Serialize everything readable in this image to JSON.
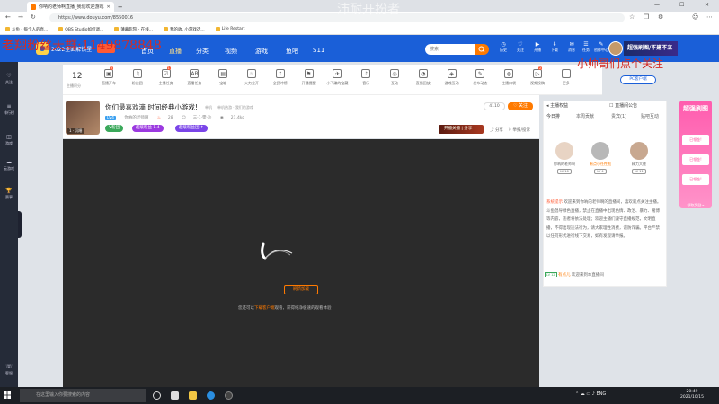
{
  "browser": {
    "tabs": [
      {
        "title": "你呐的老师啊直播_我们欢迎游戏"
      },
      {
        "title": ""
      }
    ],
    "url": "https://www.douyu.com/8550016",
    "bookmarks": [
      "斗鱼 - 每个人的直...",
      "OBS Studio如何调...",
      "薄暮影院 - 在线...",
      "我的收, 小游戏选...",
      "Life Restart"
    ],
    "window_controls": [
      "—",
      "☐",
      "✕"
    ]
  },
  "overlay": {
    "top_left": "老翔粉丝天群:1149878848",
    "top_center": "沛耐开扮者",
    "right": "小帅哥们点个关注"
  },
  "header": {
    "logo_text": "2022全面解锁星",
    "nav": [
      "首页",
      "直播",
      "分类",
      "视频",
      "游戏",
      "鱼吧",
      "S11"
    ],
    "search_placeholder": "搜索",
    "icons": [
      {
        "label": "历史",
        "glyph": "◷"
      },
      {
        "label": "关注",
        "glyph": "♡"
      },
      {
        "label": "开播",
        "glyph": "▶"
      },
      {
        "label": "下载",
        "glyph": "⬇"
      },
      {
        "label": "消息",
        "glyph": "✉"
      },
      {
        "label": "任务",
        "glyph": "☰"
      },
      {
        "label": "创作中心",
        "glyph": "✎"
      }
    ],
    "banner_text": "超强刷图/不建不立"
  },
  "left_sidebar": [
    {
      "label": "关注",
      "glyph": "♡"
    },
    {
      "label": "排行榜",
      "glyph": "≡"
    },
    {
      "label": "游戏",
      "glyph": "◫"
    },
    {
      "label": "云游戏",
      "glyph": "☁"
    },
    {
      "label": "赛事",
      "glyph": "🏆"
    },
    {
      "label": "客服",
      "glyph": "☏"
    }
  ],
  "toolbar": {
    "rank_number": "12",
    "rank_label": "主播积分",
    "items": [
      {
        "label": "直播开车",
        "glyph": "▣",
        "badge": "3"
      },
      {
        "label": "粉丝团",
        "glyph": "♫",
        "badge": ""
      },
      {
        "label": "主播任务",
        "glyph": "☑",
        "badge": "1"
      },
      {
        "label": "直播任务",
        "glyph": "AB",
        "badge": ""
      },
      {
        "label": "宝箱",
        "glyph": "▤",
        "badge": ""
      },
      {
        "label": "火力全开",
        "glyph": "♨",
        "badge": ""
      },
      {
        "label": "全民冲榜",
        "glyph": "↑",
        "badge": ""
      },
      {
        "label": "开播提醒",
        "glyph": "⚑",
        "badge": ""
      },
      {
        "label": "小飞碟的宝藏",
        "glyph": "✈",
        "badge": ""
      },
      {
        "label": "音乐",
        "glyph": "♪",
        "badge": ""
      },
      {
        "label": "互动",
        "glyph": "◎",
        "badge": ""
      },
      {
        "label": "直播回放",
        "glyph": "◔",
        "badge": ""
      },
      {
        "label": "游戏互动",
        "glyph": "◈",
        "badge": ""
      },
      {
        "label": "发布动态",
        "glyph": "✎",
        "badge": ""
      },
      {
        "label": "主播口袋",
        "glyph": "◍",
        "badge": ""
      },
      {
        "label": "视频投稿",
        "glyph": "▷",
        "badge": "2"
      },
      {
        "label": "更多",
        "glyph": "…",
        "badge": ""
      }
    ],
    "pc_client": "PC客户端"
  },
  "room": {
    "title": "你们最喜欢滴 时间经典小游戏!",
    "category": "单机",
    "subcategory": "单机热游 · 我们的游戏",
    "streamer": "你呐的老师啊",
    "heat": "28",
    "fans": "三·1·零·沙",
    "views": "21.4kg",
    "level_tag": "LV4",
    "streamer_level": "1 · 沉睡",
    "pills": [
      {
        "text": "V粉团",
        "color": "#3aa85a"
      },
      {
        "text": "超级粉丝 1.4",
        "color": "#9b3ae0"
      },
      {
        "text": "超级粉丝团 ↑",
        "color": "#7a45e8"
      }
    ],
    "follow": "关注",
    "fans_count": "4110",
    "gift_btn": "开播关播 | 分享",
    "share": "分享",
    "report": "举报/投诉"
  },
  "player": {
    "refresh": "刷新加载",
    "tip_prefix": "您还可以",
    "tip_highlight": "下载客户端",
    "tip_suffix": "观看，获得纯净极速的观看体验"
  },
  "right_panel": {
    "header1": "主播权益",
    "header2": "直播间公告",
    "tabs": [
      "今日排",
      "本周贡献",
      "贵宾(1)",
      "贴吧互动"
    ],
    "ranks": [
      {
        "name": "你呐的老师啊",
        "level": "LV 16"
      },
      {
        "name": "有点小任性啦",
        "level": "LV 4"
      },
      {
        "name": "精力大佬",
        "level": "LV 11"
      }
    ],
    "system_label": "系统提示",
    "system_message": "欢迎来到你呐的老师啊的直播间，喜欢就点关注主播。斗鱼倡导绿色直播，禁止在直播中出现色情、政治、暴力、赌博等内容，违者将依法处理；欢迎主播们遵守直播规范，文明直播，不得出现违法行为，请大家理性消费，谨防诈骗。平台严禁以任何形式进行线下交易，如有发现请举报。",
    "welcome_level": "LV 12",
    "welcome_user": "有点儿",
    "welcome_text": "欢迎来到本直播间"
  },
  "promo": {
    "title": "超强刷图",
    "boxes": [
      "已领金!",
      "已领金!",
      "已领金!"
    ],
    "footer": "领取奖励 ▸"
  },
  "taskbar": {
    "search_placeholder": "在这里输入你要搜索的内容",
    "tray": "ENG",
    "time": "20:49",
    "date": "2021/10/15"
  },
  "colors": {
    "brand_blue": "#1a5fd8",
    "accent_orange": "#ff7a00",
    "overlay_red": "#d62b22"
  }
}
